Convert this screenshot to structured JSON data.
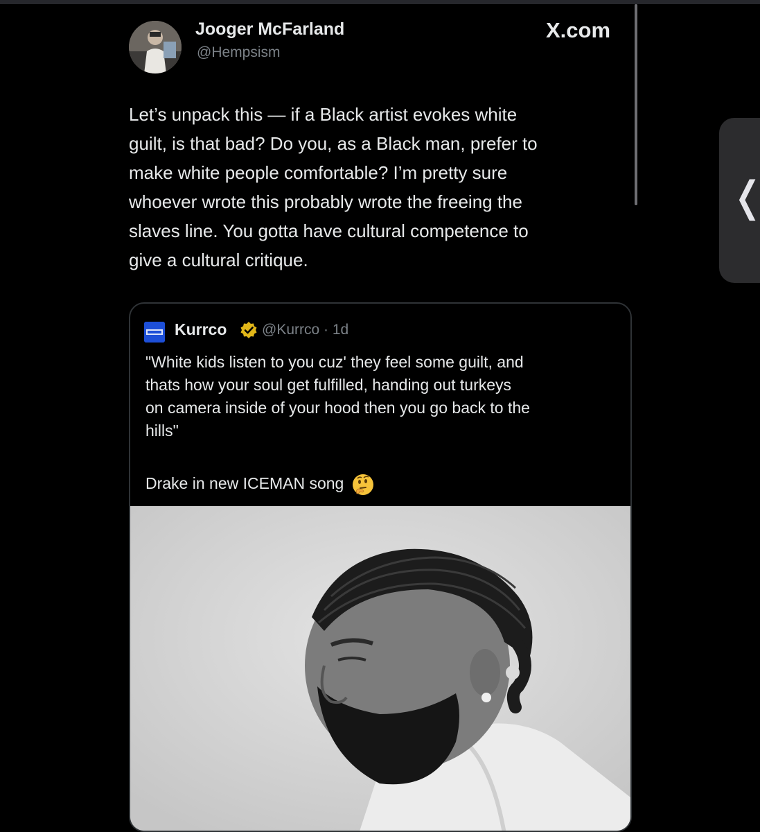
{
  "post": {
    "author_name": "Jooger McFarland",
    "author_handle": "@Hempsism",
    "site": "X.com",
    "body_lines": [
      "Let’s unpack this — if a Black artist evokes white",
      "guilt, is that bad? Do you, as a Black man, prefer to",
      "make white people comfortable? I’m pretty sure",
      "whoever wrote this probably wrote the freeing the",
      "slaves line. You gotta have cultural competence to",
      "give a cultural critique."
    ]
  },
  "quote": {
    "name": "Kurrco",
    "handle_and_time": "@Kurrco · 1d",
    "verified_icon": "verified-badge-icon",
    "body_lines": [
      "\"White kids listen to you cuz' they feel some guilt, and",
      "thats how your soul get fulfilled, handing out turkeys",
      "on camera inside of your hood then you go back to the",
      "hills\""
    ],
    "caption": "Drake in new ICEMAN song",
    "caption_emoji": "thinking-face-emoji"
  },
  "ui": {
    "side_tab_icon": "chevron-left-icon",
    "side_tab_glyph": "❬"
  },
  "colors": {
    "background": "#000000",
    "text": "#e7e9ea",
    "muted": "#7c8288",
    "verified_gold": "#e2b719",
    "kurrco_brand": "#1d4fd8"
  }
}
